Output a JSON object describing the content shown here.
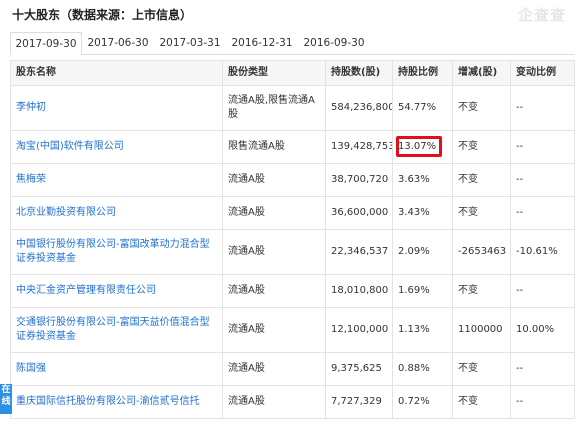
{
  "title": "十大股东（数据来源：上市信息）",
  "watermark": "企查查",
  "tabs": [
    "2017-09-30",
    "2017-06-30",
    "2017-03-31",
    "2016-12-31",
    "2016-09-30"
  ],
  "headers": [
    "股东名称",
    "股份类型",
    "持股数(股)",
    "持股比例",
    "增减(股)",
    "变动比例"
  ],
  "rows": [
    [
      "李仲初",
      "流通A股,限售流通A股",
      "584,236,800",
      "54.77%",
      "不变",
      "--"
    ],
    [
      "淘宝(中国)软件有限公司",
      "限售流通A股",
      "139,428,753",
      "13.07%",
      "不变",
      "--"
    ],
    [
      "焦梅荣",
      "流通A股",
      "38,700,720",
      "3.63%",
      "不变",
      "--"
    ],
    [
      "北京业勤投资有限公司",
      "流通A股",
      "36,600,000",
      "3.43%",
      "不变",
      "--"
    ],
    [
      "中国银行股份有限公司-富国改革动力混合型证券投资基金",
      "流通A股",
      "22,346,537",
      "2.09%",
      "-2653463",
      "-10.61%"
    ],
    [
      "中央汇金资产管理有限责任公司",
      "流通A股",
      "18,010,800",
      "1.69%",
      "不变",
      "--"
    ],
    [
      "交通银行股份有限公司-富国天益价值混合型证券投资基金",
      "流通A股",
      "12,100,000",
      "1.13%",
      "1100000",
      "10.00%"
    ],
    [
      "陈国强",
      "流通A股",
      "9,375,625",
      "0.88%",
      "不变",
      "--"
    ],
    [
      "重庆国际信托股份有限公司-渝信贰号信托",
      "流通A股",
      "7,727,329",
      "0.72%",
      "不变",
      "--"
    ]
  ],
  "side_tab": "在线"
}
